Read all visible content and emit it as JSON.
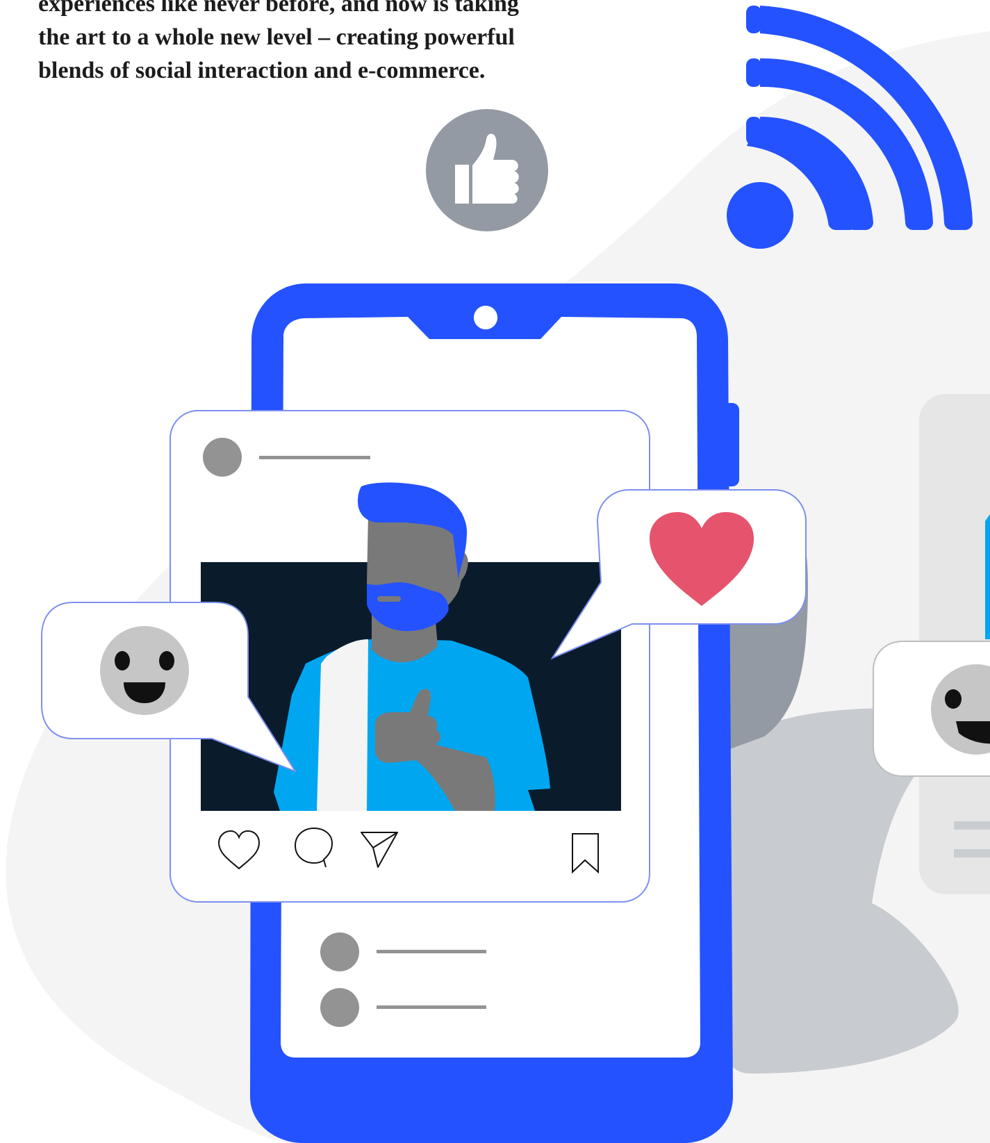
{
  "intro": {
    "lines": [
      "experiences like never before, and now is taking",
      "the art to a whole new level – creating powerful",
      "blends of social interaction and e-commerce."
    ]
  },
  "illustration": {
    "icons": [
      "wifi-icon",
      "thumbs-up-icon",
      "heart-icon",
      "smiley-icon",
      "comment-icon",
      "send-icon",
      "bookmark-icon"
    ]
  },
  "colors": {
    "brand_blue": "#2452ff",
    "accent_cyan": "#00a6f0",
    "dark_navy": "#0a1c2c",
    "heart_red": "#e5546c",
    "gray": "#939aa3",
    "light_bg": "#f4f4f4"
  }
}
